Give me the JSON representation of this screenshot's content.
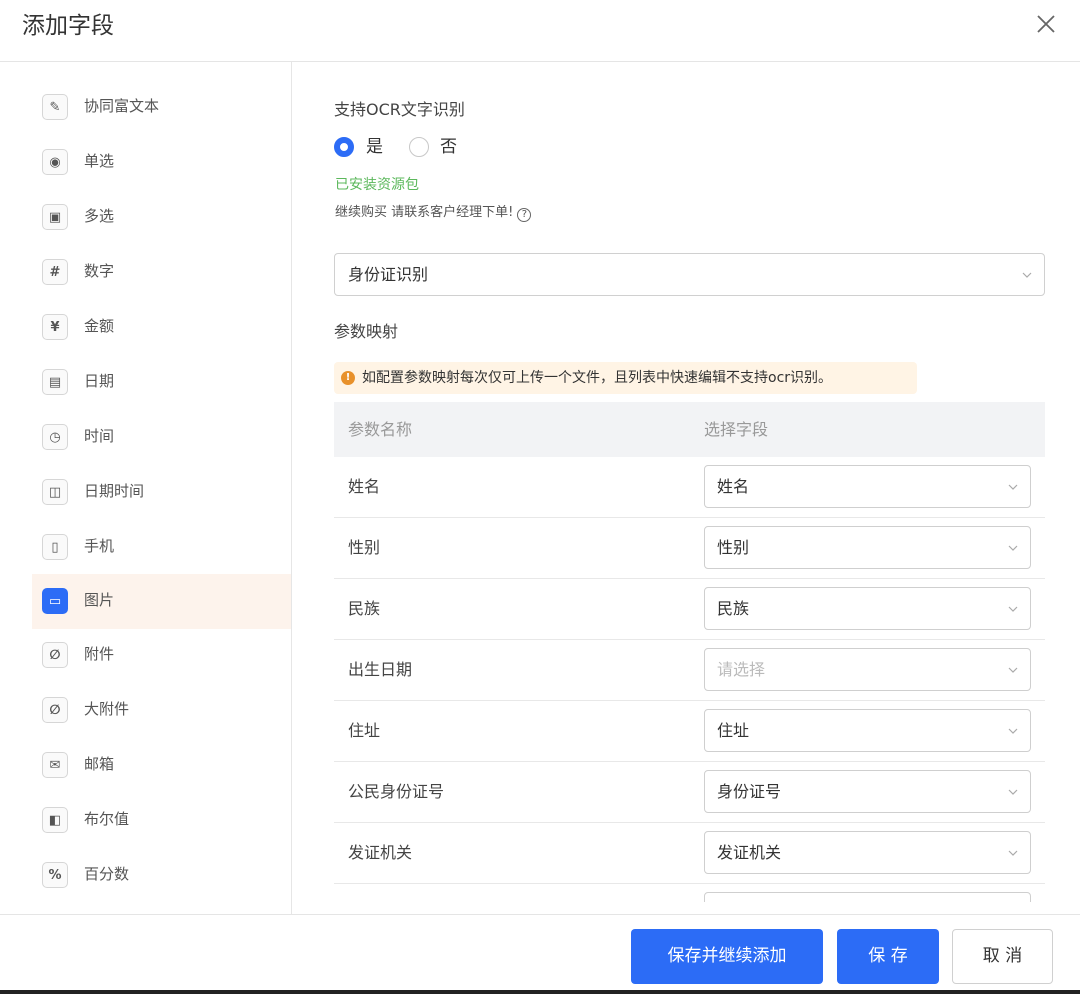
{
  "dialog": {
    "title": "添加字段"
  },
  "sidebar": {
    "items": [
      {
        "label": "协同富文本",
        "icon": "rich-text-icon",
        "glyph": "✎"
      },
      {
        "label": "单选",
        "icon": "radio-icon",
        "glyph": "◉"
      },
      {
        "label": "多选",
        "icon": "checkbox-icon",
        "glyph": "▣"
      },
      {
        "label": "数字",
        "icon": "hash-icon",
        "glyph": "#"
      },
      {
        "label": "金额",
        "icon": "yen-icon",
        "glyph": "¥"
      },
      {
        "label": "日期",
        "icon": "calendar-icon",
        "glyph": "▤"
      },
      {
        "label": "时间",
        "icon": "clock-icon",
        "glyph": "◷"
      },
      {
        "label": "日期时间",
        "icon": "datetime-icon",
        "glyph": "◫"
      },
      {
        "label": "手机",
        "icon": "phone-icon",
        "glyph": "▯"
      },
      {
        "label": "图片",
        "icon": "image-icon",
        "glyph": "▭"
      },
      {
        "label": "附件",
        "icon": "paperclip-icon",
        "glyph": "∅"
      },
      {
        "label": "大附件",
        "icon": "large-attachment-icon",
        "glyph": "∅"
      },
      {
        "label": "邮箱",
        "icon": "mail-icon",
        "glyph": "✉"
      },
      {
        "label": "布尔值",
        "icon": "boolean-icon",
        "glyph": "◧"
      },
      {
        "label": "百分数",
        "icon": "percent-icon",
        "glyph": "%"
      }
    ],
    "active_index": 9
  },
  "ocr": {
    "label": "支持OCR文字识别",
    "yes": "是",
    "no": "否",
    "selected": "是",
    "installed": "已安装资源包",
    "hint": "继续购买 请联系客户经理下单!",
    "help_glyph": "?"
  },
  "recognition": {
    "value": "身份证识别"
  },
  "mapping": {
    "label": "参数映射",
    "warning": "如配置参数映射每次仅可上传一个文件，且列表中快速编辑不支持ocr识别。",
    "warning_glyph": "!",
    "headers": [
      "参数名称",
      "选择字段"
    ],
    "rows": [
      {
        "param": "姓名",
        "field": "姓名"
      },
      {
        "param": "性别",
        "field": "性别"
      },
      {
        "param": "民族",
        "field": "民族"
      },
      {
        "param": "出生日期",
        "field": "",
        "placeholder": "请选择"
      },
      {
        "param": "住址",
        "field": "住址"
      },
      {
        "param": "公民身份证号",
        "field": "身份证号"
      },
      {
        "param": "发证机关",
        "field": "发证机关"
      }
    ]
  },
  "footer": {
    "save_continue": "保存并继续添加",
    "save": "保 存",
    "cancel": "取 消"
  },
  "colors": {
    "primary": "#2c6cf6",
    "success": "#5cb85c",
    "warning": "#e8912b"
  }
}
